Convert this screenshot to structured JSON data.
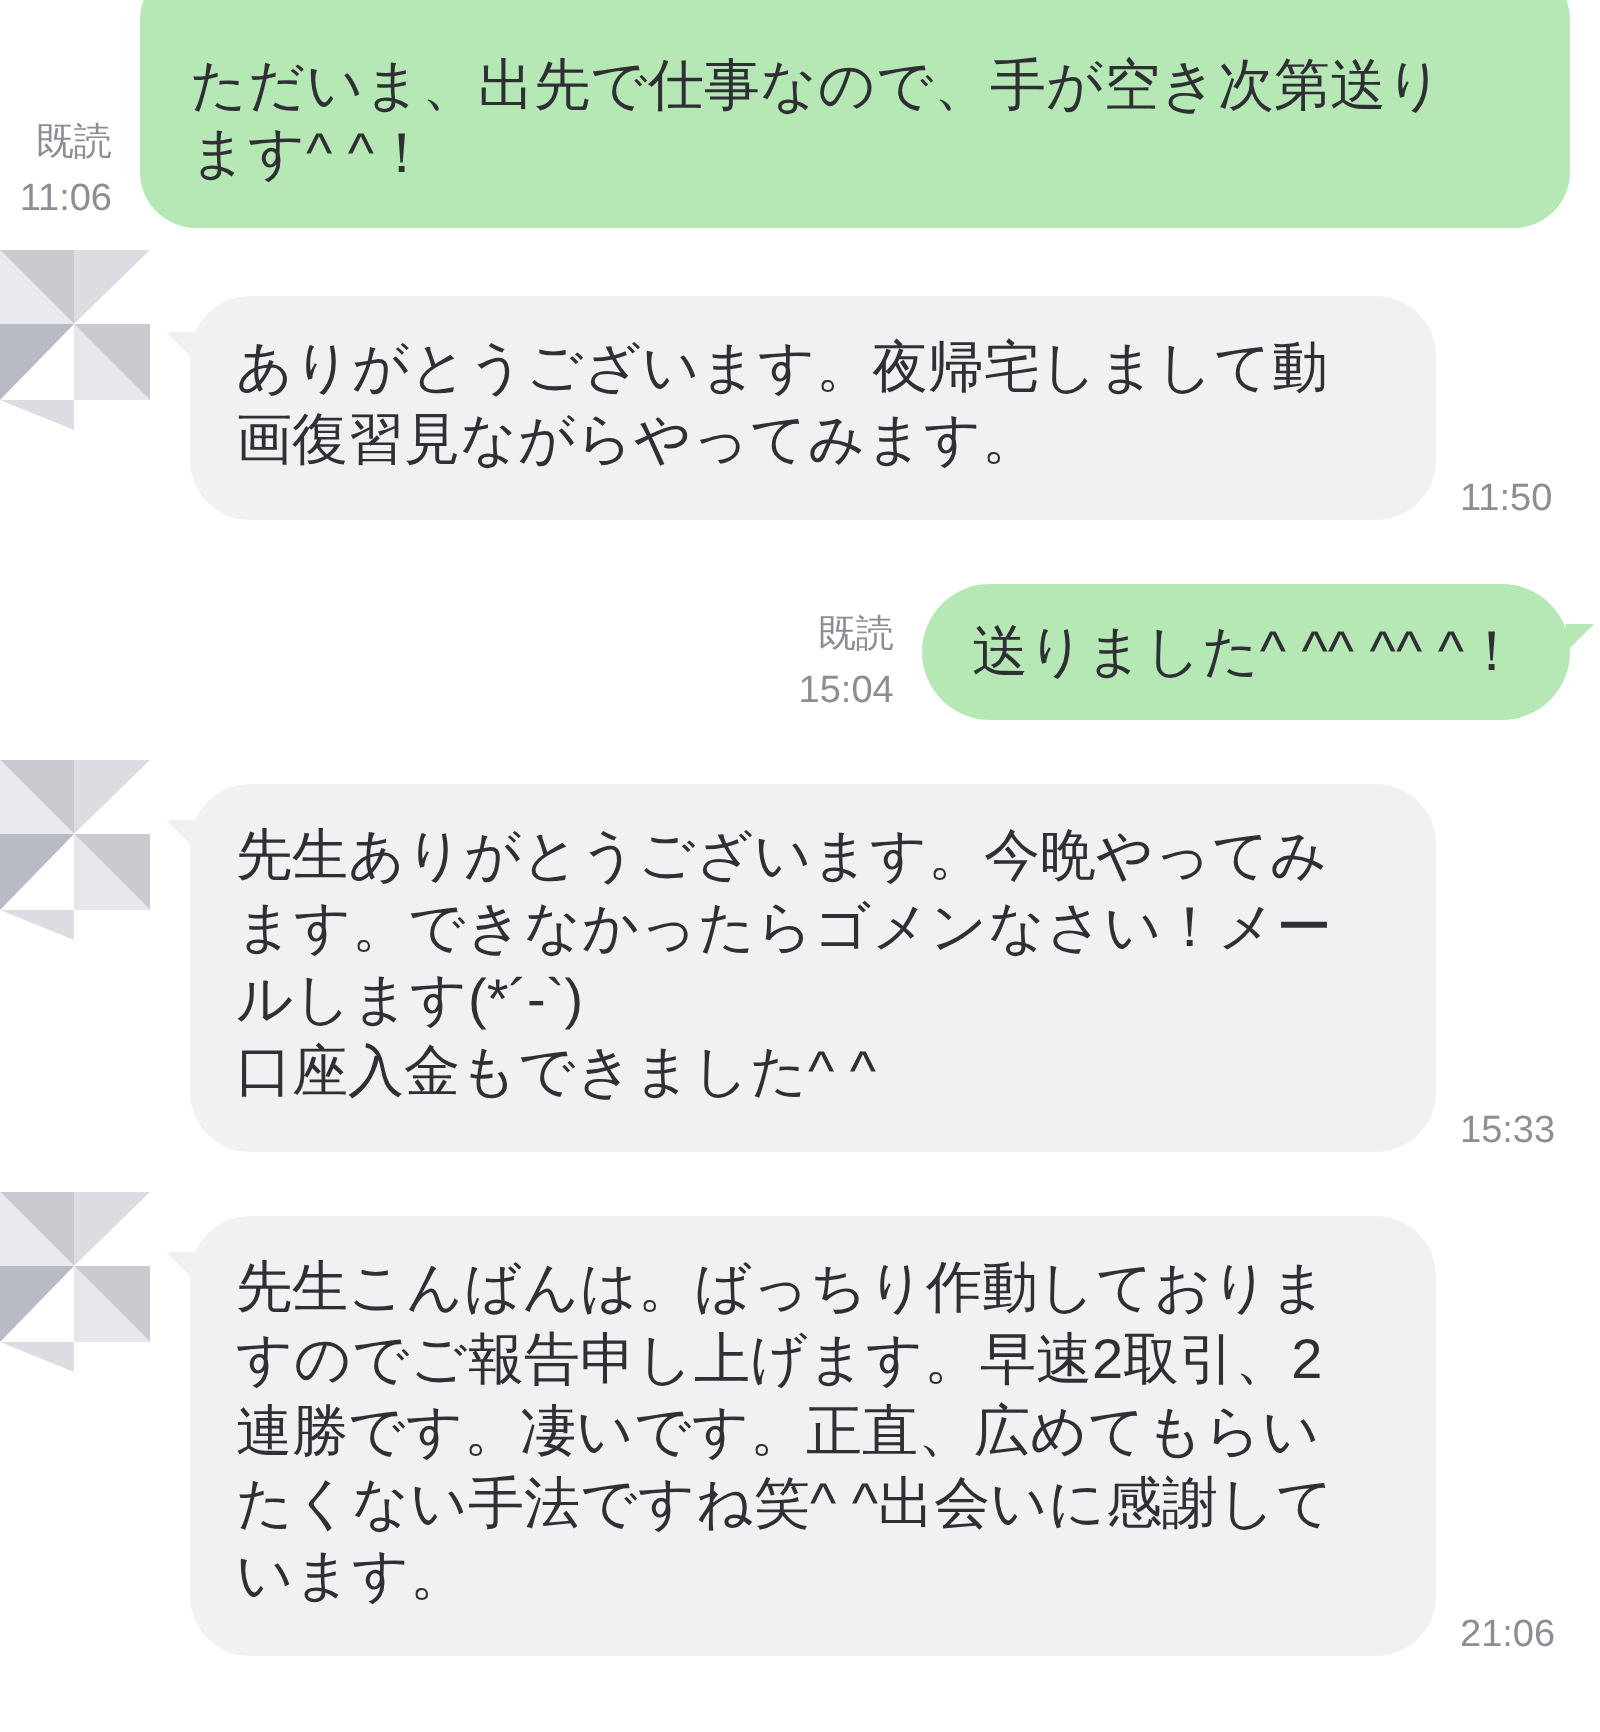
{
  "messages": [
    {
      "kind": "sent",
      "lines": [
        "ただいま、出先で仕事なので、手が空き次第送り",
        "ます^ ^！"
      ],
      "read": "既読",
      "time": "11:06",
      "tail": false
    },
    {
      "kind": "received",
      "lines": [
        "ありがとうございます。夜帰宅しまして動",
        "画復習見ながらやってみます。"
      ],
      "time": "11:50"
    },
    {
      "kind": "sent",
      "lines": [
        "送りました^ ^^ ^^ ^！"
      ],
      "read": "既読",
      "time": "15:04",
      "tail": true
    },
    {
      "kind": "received",
      "lines": [
        "先生ありがとうございます。今晩やってみ",
        "ます。できなかったらゴメンなさい！メー",
        "ルします(*´-`)",
        "口座入金もできました^ ^"
      ],
      "time": "15:33"
    },
    {
      "kind": "received",
      "lines": [
        "先生こんばんは。ばっちり作動しておりま",
        "すのでご報告申し上げます。早速2取引、2",
        "連勝です。凄いです。正直、広めてもらい",
        "たくない手法ですね笑^ ^出会いに感謝して",
        "います。"
      ],
      "time": "21:06"
    }
  ]
}
